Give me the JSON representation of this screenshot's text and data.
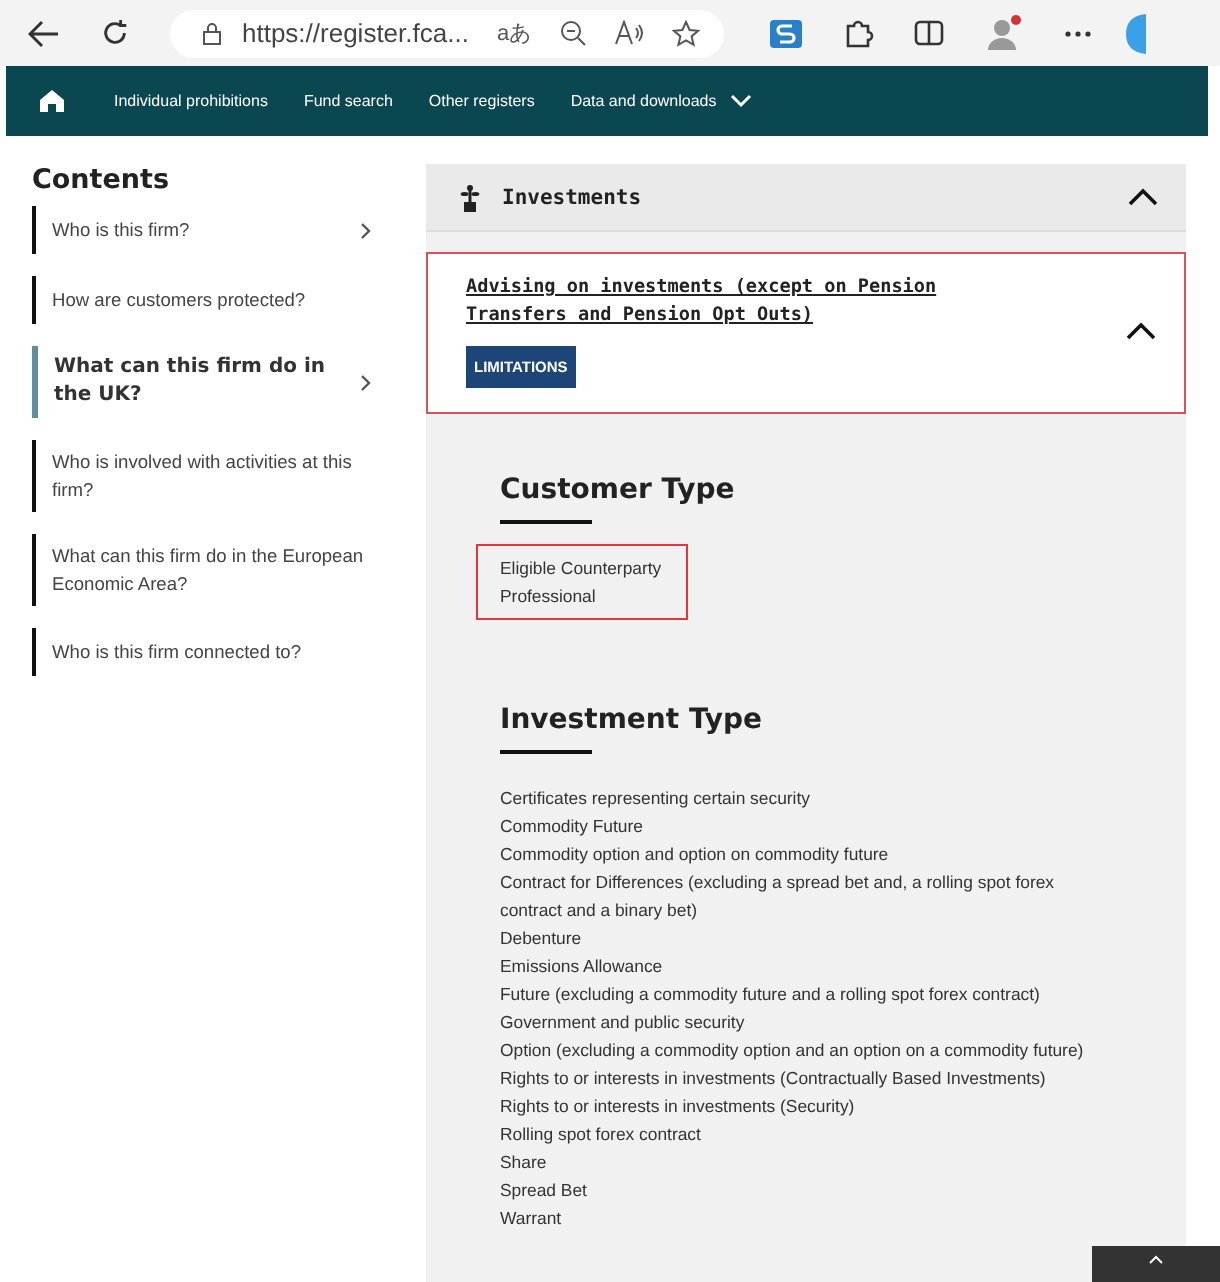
{
  "browser": {
    "url": "https://register.fca...",
    "translate_glyph": "aあ",
    "profile_notification": true
  },
  "nav": {
    "items": [
      {
        "label": "Individual prohibitions",
        "has_menu": false
      },
      {
        "label": "Fund search",
        "has_menu": false
      },
      {
        "label": "Other registers",
        "has_menu": false
      },
      {
        "label": "Data and downloads",
        "has_menu": true
      }
    ]
  },
  "sidebar": {
    "title": "Contents",
    "items": [
      {
        "label": "Who is this firm?",
        "selected": false,
        "has_arrow": true
      },
      {
        "label": "How are customers protected?",
        "selected": false,
        "has_arrow": false
      },
      {
        "label": "What can this firm do in the UK?",
        "selected": true,
        "has_arrow": true
      },
      {
        "label": "Who is involved with activities at this firm?",
        "selected": false,
        "has_arrow": false
      },
      {
        "label": "What can this firm do in the European Economic Area?",
        "selected": false,
        "has_arrow": false
      },
      {
        "label": "Who is this firm connected to?",
        "selected": false,
        "has_arrow": false
      }
    ]
  },
  "category": {
    "title": "Investments",
    "expanded": true
  },
  "activity": {
    "title": "Advising on investments (except on Pension Transfers and Pension Opt Outs)",
    "badge": "LIMITATIONS",
    "expanded": true,
    "highlighted": true
  },
  "groups": [
    {
      "heading": "Customer Type",
      "highlighted": true,
      "items": [
        "Eligible Counterparty",
        "Professional"
      ]
    },
    {
      "heading": "Investment Type",
      "highlighted": false,
      "items": [
        "Certificates representing certain security",
        "Commodity Future",
        "Commodity option and option on commodity future",
        "Contract for Differences (excluding a spread bet and, a rolling spot forex contract and a binary bet)",
        "Debenture",
        "Emissions Allowance",
        "Future (excluding a commodity future and a rolling spot forex contract)",
        "Government and public security",
        "Option (excluding a commodity option and an option on a commodity future)",
        "Rights to or interests in investments (Contractually Based Investments)",
        "Rights to or interests in investments (Security)",
        "Rolling spot forex contract",
        "Share",
        "Spread Bet",
        "Warrant"
      ]
    }
  ]
}
